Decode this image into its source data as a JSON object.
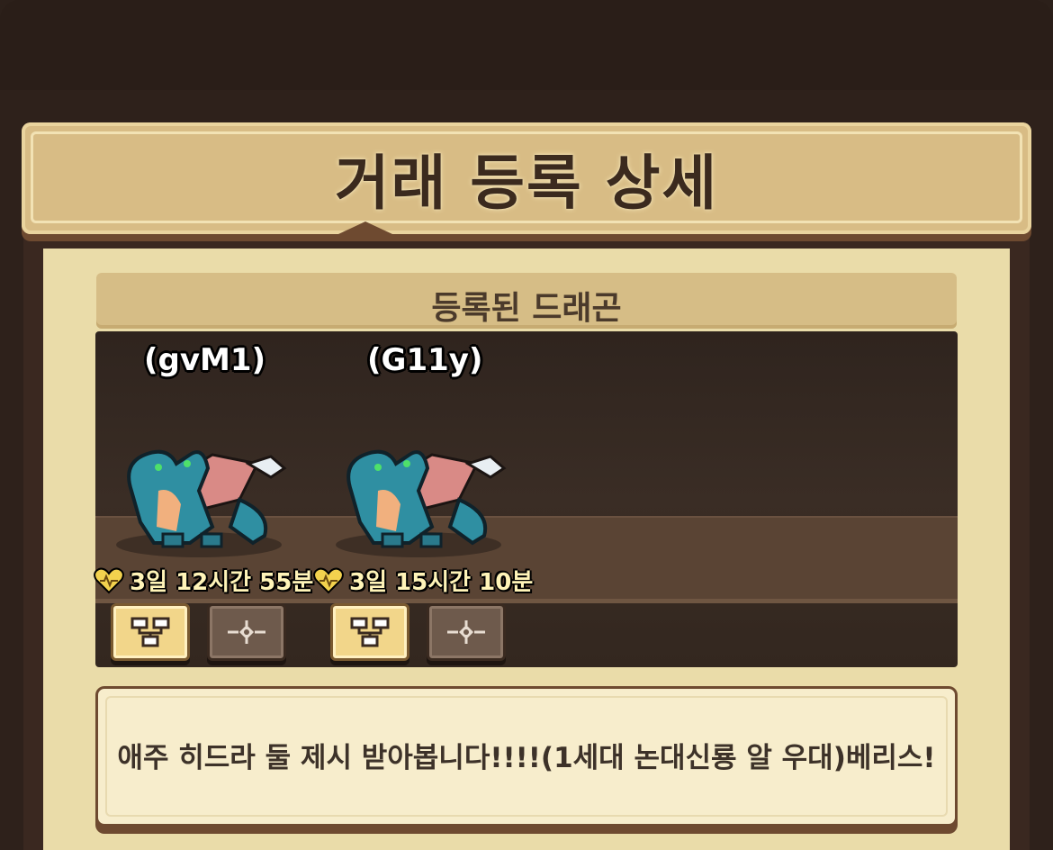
{
  "title": "거래 등록 상세",
  "section_header": "등록된 드래곤",
  "dragons": [
    {
      "name": "(gvM1)",
      "timer": "3일 12시간 55분",
      "icon": "heart-icon"
    },
    {
      "name": "(G11y)",
      "timer": "3일 15시간 10분",
      "icon": "heart-icon"
    }
  ],
  "buttons": {
    "lineage_icon": "family-tree-icon",
    "locate_icon": "target-icon"
  },
  "message": "애주 히드라 둘 제시 받아봅니다!!!!(1세대 논대신룡 알 우대)베리스!",
  "colors": {
    "panel": "#eadca9",
    "banner": "#d8bc85",
    "dark": "#2e211b",
    "timer_text": "#fff4b8"
  }
}
